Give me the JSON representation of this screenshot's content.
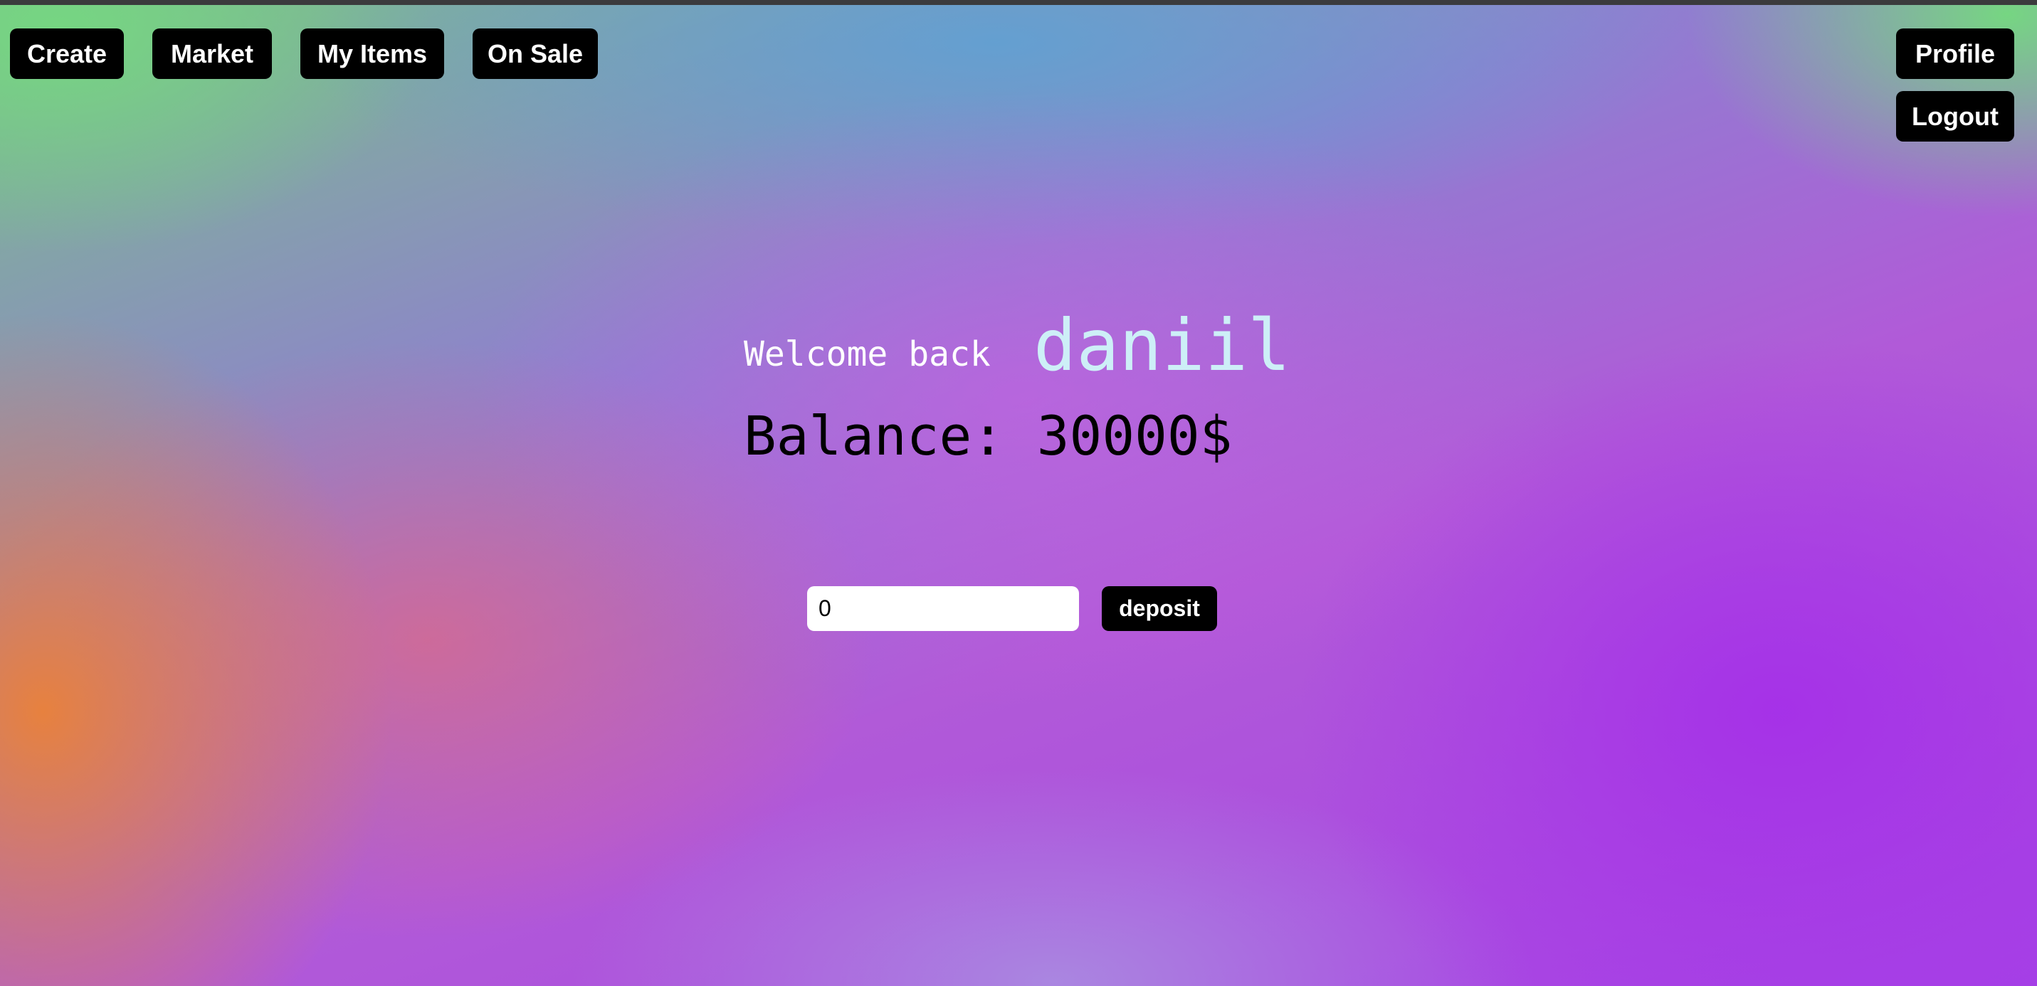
{
  "nav": {
    "create": "Create",
    "market": "Market",
    "my_items": "My Items",
    "on_sale": "On Sale",
    "profile": "Profile",
    "logout": "Logout"
  },
  "welcome": {
    "prefix": "Welcome back",
    "username": "daniil"
  },
  "balance": {
    "text": "Balance: 30000$"
  },
  "deposit": {
    "input_value": "0",
    "button_label": "deposit"
  },
  "colors": {
    "button_bg": "#000000",
    "button_text": "#ffffff",
    "username_color": "#cdeff7"
  }
}
